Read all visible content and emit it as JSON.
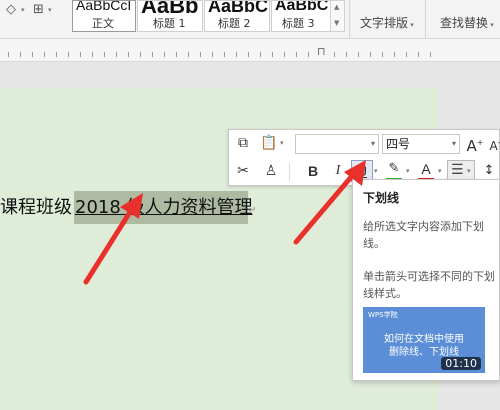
{
  "ribbon": {
    "styles": [
      {
        "sample": "AaBbCcI",
        "label": "正文"
      },
      {
        "sample": "AaBb",
        "label": "标题 1"
      },
      {
        "sample": "AaBbC",
        "label": "标题 2"
      },
      {
        "sample": "AaBbC",
        "label": "标题 3"
      }
    ],
    "text_layout_label": "文字排版",
    "find_replace_label": "查找替换"
  },
  "document": {
    "line_prefix": "课程班级 ",
    "selected_text": "2018 级人力资料管理",
    "para_mark": "↵"
  },
  "mini_toolbar": {
    "font_name_value": "",
    "font_size_value": "四号",
    "bold": "B",
    "italic": "I",
    "underline": "U",
    "font_color": "A"
  },
  "tooltip": {
    "title": "下划线",
    "para1": "给所选文字内容添加下划线。",
    "para2": "单击箭头可选择不同的下划线样式。",
    "thumb_brand": "WPS学院",
    "thumb_line1": "如何在文档中使用",
    "thumb_line2": "删除线、下划线",
    "thumb_time": "01:10"
  },
  "colors": {
    "page": "#dfecd8",
    "selection": "#aebaa2",
    "arrow": "#e8312a",
    "highlight_bar": "#2fb52f",
    "font_color_bar": "#e02020",
    "thumb_bg": "#5b8ed6"
  }
}
